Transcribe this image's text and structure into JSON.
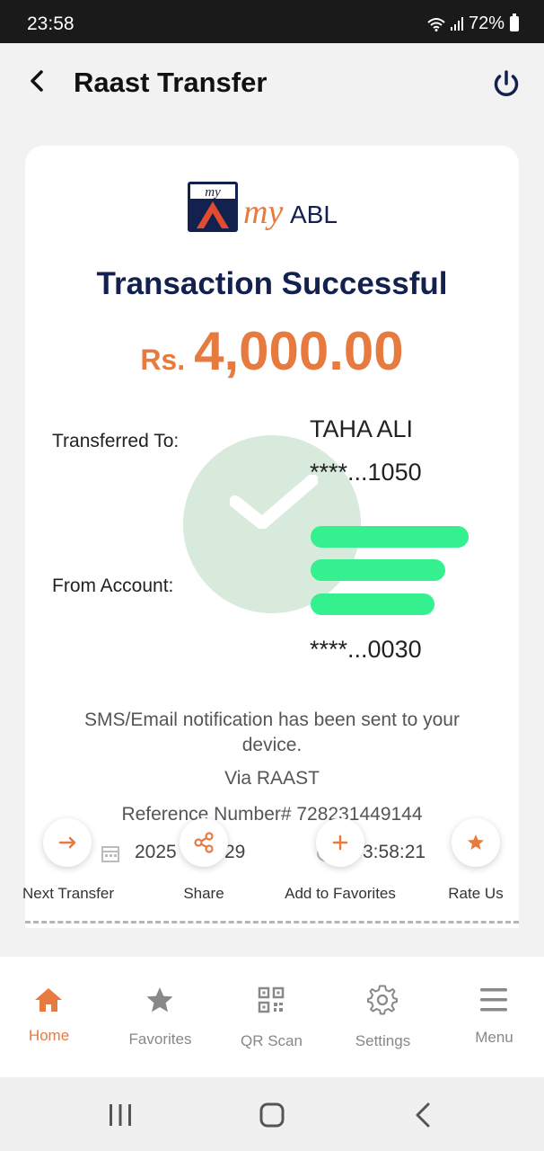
{
  "status_bar": {
    "time": "23:58",
    "battery": "72%"
  },
  "header": {
    "title": "Raast Transfer"
  },
  "logo": {
    "my": "my",
    "my_script": "my",
    "abl": "ABL"
  },
  "receipt": {
    "status": "Transaction Successful",
    "currency": "Rs.",
    "amount": "4,000.00",
    "transferred_to_label": "Transferred To:",
    "to_name": "TAHA ALI",
    "to_account": "****...1050",
    "from_account_label": "From Account:",
    "from_account_number": "****...0030",
    "notification": "SMS/Email notification has been sent to your device.",
    "via": "Via RAAST",
    "reference": "Reference Number# 728231449144",
    "date_fragment_1": "2025",
    "date_fragment_2": "29",
    "time_fragment": "3:58:21"
  },
  "actions": [
    {
      "label": "Next Transfer",
      "icon": "arrow-right-icon"
    },
    {
      "label": "Share",
      "icon": "share-icon"
    },
    {
      "label": "Add to Favorites",
      "icon": "plus-icon"
    },
    {
      "label": "Rate Us",
      "icon": "star-icon"
    }
  ],
  "bottom_nav": [
    {
      "label": "Home",
      "icon": "home-icon",
      "active": true
    },
    {
      "label": "Favorites",
      "icon": "star-icon",
      "active": false
    },
    {
      "label": "QR Scan",
      "icon": "qr-icon",
      "active": false
    },
    {
      "label": "Settings",
      "icon": "gear-icon",
      "active": false
    },
    {
      "label": "Menu",
      "icon": "hamburger-icon",
      "active": false
    }
  ],
  "colors": {
    "accent": "#e77b3f",
    "navy": "#13214f",
    "success_bg": "#d7eadb",
    "mask": "#34f08f"
  }
}
